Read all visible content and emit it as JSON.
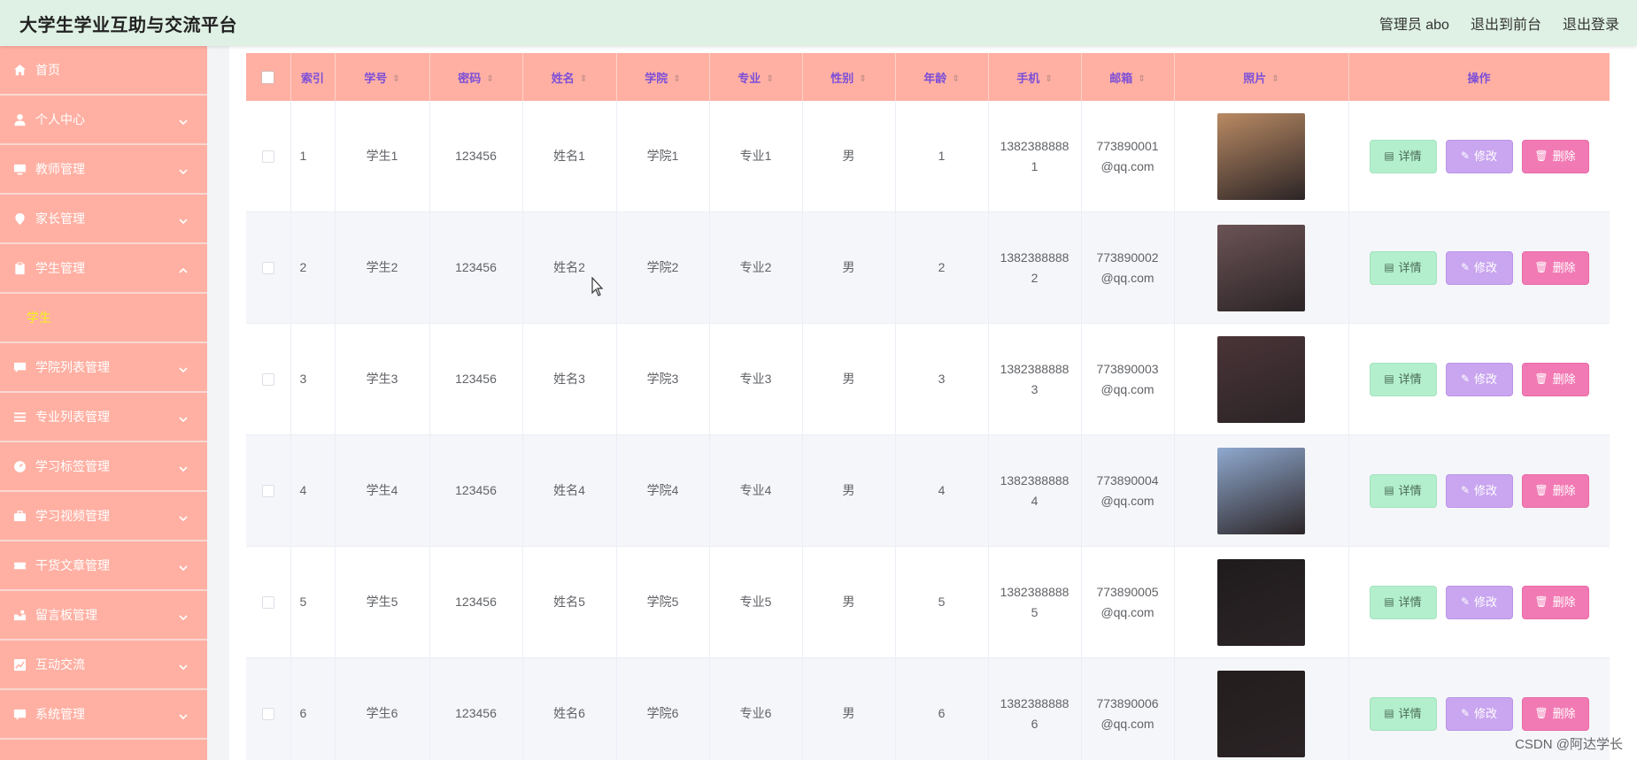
{
  "header": {
    "title": "大学生学业互助与交流平台",
    "user": "管理员 abo",
    "to_front": "退出到前台",
    "logout": "退出登录"
  },
  "sidebar": {
    "items": [
      {
        "label": "首页",
        "icon": "home-icon",
        "expandable": false
      },
      {
        "label": "个人中心",
        "icon": "user-icon",
        "expandable": true
      },
      {
        "label": "教师管理",
        "icon": "monitor-icon",
        "expandable": true
      },
      {
        "label": "家长管理",
        "icon": "location-icon",
        "expandable": true
      },
      {
        "label": "学生管理",
        "icon": "clipboard-icon",
        "expandable": true,
        "expanded": true
      },
      {
        "label": "学院列表管理",
        "icon": "chat-icon",
        "expandable": true
      },
      {
        "label": "专业列表管理",
        "icon": "list-icon",
        "expandable": true
      },
      {
        "label": "学习标签管理",
        "icon": "gauge-icon",
        "expandable": true
      },
      {
        "label": "学习视频管理",
        "icon": "briefcase-icon",
        "expandable": true
      },
      {
        "label": "干货文章管理",
        "icon": "ticket-icon",
        "expandable": true
      },
      {
        "label": "留言板管理",
        "icon": "mailbox-icon",
        "expandable": true
      },
      {
        "label": "互动交流",
        "icon": "chart-icon",
        "expandable": true
      },
      {
        "label": "系统管理",
        "icon": "message-icon",
        "expandable": true
      }
    ],
    "submenu": {
      "label": "学生"
    }
  },
  "table": {
    "headers": {
      "index": "索引",
      "student_no": "学号",
      "password": "密码",
      "name": "姓名",
      "college": "学院",
      "major": "专业",
      "gender": "性别",
      "age": "年龄",
      "phone": "手机",
      "email": "邮箱",
      "photo": "照片",
      "actions": "操作"
    },
    "rows": [
      {
        "index": "1",
        "student_no": "学生1",
        "password": "123456",
        "name": "姓名1",
        "college": "学院1",
        "major": "专业1",
        "gender": "男",
        "age": "1",
        "phone": "13823888881",
        "email": "773890001@qq.com",
        "photo_color": "#b98a63"
      },
      {
        "index": "2",
        "student_no": "学生2",
        "password": "123456",
        "name": "姓名2",
        "college": "学院2",
        "major": "专业2",
        "gender": "男",
        "age": "2",
        "phone": "13823888882",
        "email": "773890002@qq.com",
        "photo_color": "#6b5356"
      },
      {
        "index": "3",
        "student_no": "学生3",
        "password": "123456",
        "name": "姓名3",
        "college": "学院3",
        "major": "专业3",
        "gender": "男",
        "age": "3",
        "phone": "13823888883",
        "email": "773890003@qq.com",
        "photo_color": "#4a3438"
      },
      {
        "index": "4",
        "student_no": "学生4",
        "password": "123456",
        "name": "姓名4",
        "college": "学院4",
        "major": "专业4",
        "gender": "男",
        "age": "4",
        "phone": "13823888884",
        "email": "773890004@qq.com",
        "photo_color": "#8fa9cf"
      },
      {
        "index": "5",
        "student_no": "学生5",
        "password": "123456",
        "name": "姓名5",
        "college": "学院5",
        "major": "专业5",
        "gender": "男",
        "age": "5",
        "phone": "13823888885",
        "email": "773890005@qq.com",
        "photo_color": "#1f1b1c"
      },
      {
        "index": "6",
        "student_no": "学生6",
        "password": "123456",
        "name": "姓名6",
        "college": "学院6",
        "major": "专业6",
        "gender": "男",
        "age": "6",
        "phone": "13823888886",
        "email": "773890006@qq.com",
        "photo_color": "#231d1d"
      }
    ],
    "actions": {
      "detail": "详情",
      "edit": "修改",
      "delete": "删除"
    }
  },
  "watermark": "CSDN @阿达学长",
  "colors": {
    "header_bg": "#dff1e5",
    "sidebar_bg": "#ffb0a3",
    "table_header_bg": "#ffb0a3",
    "table_header_text": "#7b4fd8",
    "active_submenu": "#f4f21a",
    "detail_btn": "#b3efcc",
    "edit_btn": "#c9a6ef",
    "delete_btn": "#f27ab4"
  }
}
